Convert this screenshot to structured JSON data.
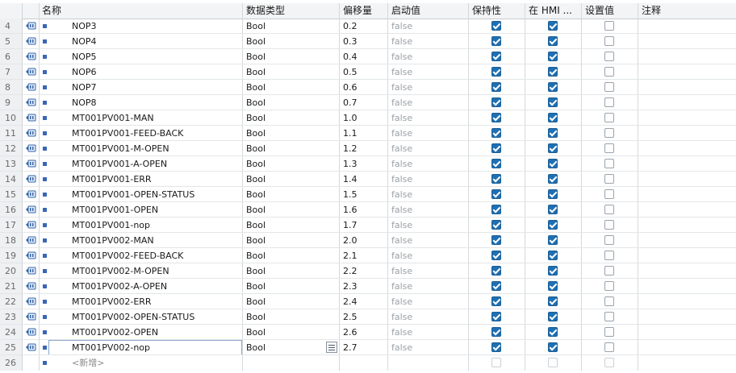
{
  "columns": {
    "name": "名称",
    "type": "数据类型",
    "offset": "偏移量",
    "start": "启动值",
    "retain": "保持性",
    "hmi": "在 HMI ...",
    "setpoint": "设置值",
    "comment": "注释"
  },
  "rows": [
    {
      "num": "4",
      "name": "NOP3",
      "type": "Bool",
      "offset": "0.2",
      "start": "false",
      "retain": true,
      "hmi": true,
      "setpoint": false
    },
    {
      "num": "5",
      "name": "NOP4",
      "type": "Bool",
      "offset": "0.3",
      "start": "false",
      "retain": true,
      "hmi": true,
      "setpoint": false
    },
    {
      "num": "6",
      "name": "NOP5",
      "type": "Bool",
      "offset": "0.4",
      "start": "false",
      "retain": true,
      "hmi": true,
      "setpoint": false
    },
    {
      "num": "7",
      "name": "NOP6",
      "type": "Bool",
      "offset": "0.5",
      "start": "false",
      "retain": true,
      "hmi": true,
      "setpoint": false
    },
    {
      "num": "8",
      "name": "NOP7",
      "type": "Bool",
      "offset": "0.6",
      "start": "false",
      "retain": true,
      "hmi": true,
      "setpoint": false
    },
    {
      "num": "9",
      "name": "NOP8",
      "type": "Bool",
      "offset": "0.7",
      "start": "false",
      "retain": true,
      "hmi": true,
      "setpoint": false
    },
    {
      "num": "10",
      "name": "MT001PV001-MAN",
      "type": "Bool",
      "offset": "1.0",
      "start": "false",
      "retain": true,
      "hmi": true,
      "setpoint": false
    },
    {
      "num": "11",
      "name": "MT001PV001-FEED-BACK",
      "type": "Bool",
      "offset": "1.1",
      "start": "false",
      "retain": true,
      "hmi": true,
      "setpoint": false
    },
    {
      "num": "12",
      "name": "MT001PV001-M-OPEN",
      "type": "Bool",
      "offset": "1.2",
      "start": "false",
      "retain": true,
      "hmi": true,
      "setpoint": false
    },
    {
      "num": "13",
      "name": "MT001PV001-A-OPEN",
      "type": "Bool",
      "offset": "1.3",
      "start": "false",
      "retain": true,
      "hmi": true,
      "setpoint": false
    },
    {
      "num": "14",
      "name": "MT001PV001-ERR",
      "type": "Bool",
      "offset": "1.4",
      "start": "false",
      "retain": true,
      "hmi": true,
      "setpoint": false
    },
    {
      "num": "15",
      "name": "MT001PV001-OPEN-STATUS",
      "type": "Bool",
      "offset": "1.5",
      "start": "false",
      "retain": true,
      "hmi": true,
      "setpoint": false
    },
    {
      "num": "16",
      "name": "MT001PV001-OPEN",
      "type": "Bool",
      "offset": "1.6",
      "start": "false",
      "retain": true,
      "hmi": true,
      "setpoint": false
    },
    {
      "num": "17",
      "name": "MT001PV001-nop",
      "type": "Bool",
      "offset": "1.7",
      "start": "false",
      "retain": true,
      "hmi": true,
      "setpoint": false
    },
    {
      "num": "18",
      "name": "MT001PV002-MAN",
      "type": "Bool",
      "offset": "2.0",
      "start": "false",
      "retain": true,
      "hmi": true,
      "setpoint": false
    },
    {
      "num": "19",
      "name": "MT001PV002-FEED-BACK",
      "type": "Bool",
      "offset": "2.1",
      "start": "false",
      "retain": true,
      "hmi": true,
      "setpoint": false
    },
    {
      "num": "20",
      "name": "MT001PV002-M-OPEN",
      "type": "Bool",
      "offset": "2.2",
      "start": "false",
      "retain": true,
      "hmi": true,
      "setpoint": false
    },
    {
      "num": "21",
      "name": "MT001PV002-A-OPEN",
      "type": "Bool",
      "offset": "2.3",
      "start": "false",
      "retain": true,
      "hmi": true,
      "setpoint": false
    },
    {
      "num": "22",
      "name": "MT001PV002-ERR",
      "type": "Bool",
      "offset": "2.4",
      "start": "false",
      "retain": true,
      "hmi": true,
      "setpoint": false
    },
    {
      "num": "23",
      "name": "MT001PV002-OPEN-STATUS",
      "type": "Bool",
      "offset": "2.5",
      "start": "false",
      "retain": true,
      "hmi": true,
      "setpoint": false
    },
    {
      "num": "24",
      "name": "MT001PV002-OPEN",
      "type": "Bool",
      "offset": "2.6",
      "start": "false",
      "retain": true,
      "hmi": true,
      "setpoint": false
    },
    {
      "num": "25",
      "name": "MT001PV002-nop",
      "type": "Bool",
      "offset": "2.7",
      "start": "false",
      "retain": true,
      "hmi": true,
      "setpoint": false,
      "selected": true
    }
  ],
  "add_row": {
    "num": "26",
    "label": "<新增>"
  },
  "icons": {
    "row_icon": "db-tag-icon",
    "bullet": "member-bullet-icon",
    "type_picker": "type-list-icon"
  },
  "colors": {
    "accent": "#1f6fb3",
    "bullet": "#3a66b5"
  }
}
